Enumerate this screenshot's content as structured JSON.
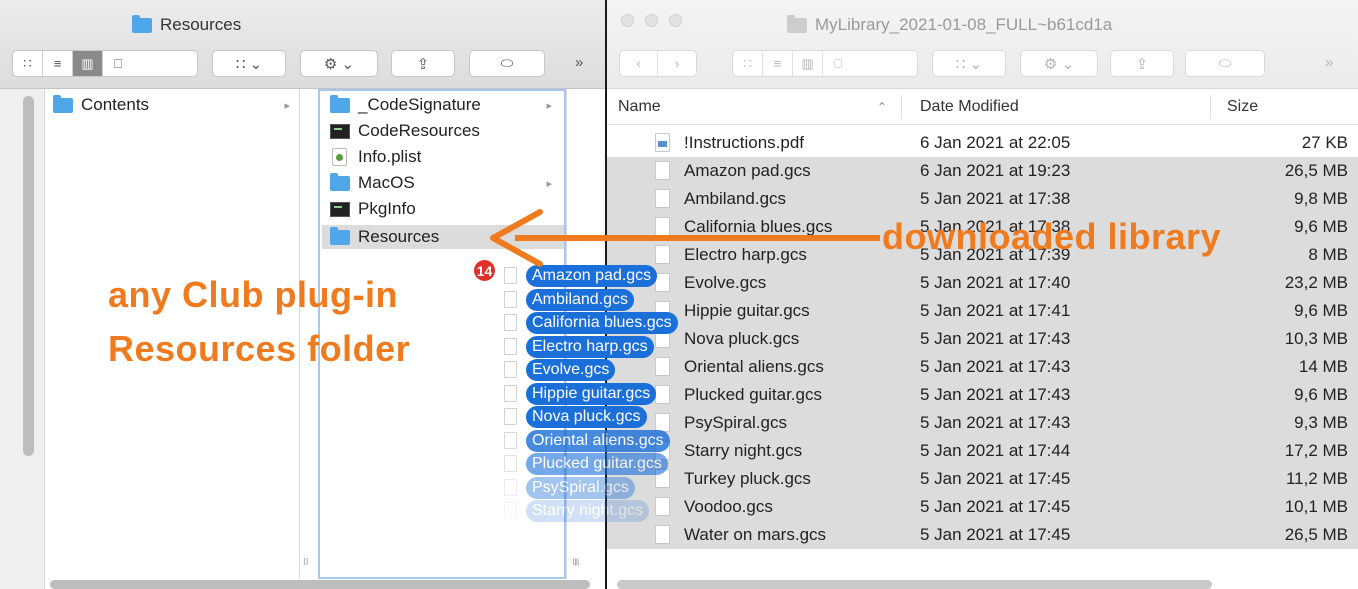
{
  "left_window": {
    "title": "Resources",
    "toolbar": {
      "view_icon": "∷",
      "list_icon": "≡",
      "column_icon": "▥",
      "gallery_icon": "⎕",
      "group_label": "∷ ⌄",
      "action_label": "⚙ ⌄",
      "share_label": "⇪",
      "tag_label": "⬭",
      "more_label": "»"
    },
    "column1": [
      {
        "label": "Contents",
        "icon": "folder-icon",
        "expandable": true
      }
    ],
    "column2": [
      {
        "label": "_CodeSignature",
        "icon": "folder-icon",
        "expandable": true
      },
      {
        "label": "CodeResources",
        "icon": "document-icon",
        "expandable": false
      },
      {
        "label": "Info.plist",
        "icon": "plist-icon",
        "expandable": false
      },
      {
        "label": "MacOS",
        "icon": "folder-icon",
        "expandable": true
      },
      {
        "label": "PkgInfo",
        "icon": "document-icon",
        "expandable": false
      },
      {
        "label": "Resources",
        "icon": "folder-icon",
        "expandable": true,
        "selected": true
      }
    ],
    "column_grip": "II",
    "chevron": "▸"
  },
  "right_window": {
    "title": "MyLibrary_2021-01-08_FULL~b61cd1a",
    "toolbar": {
      "back_label": "‹",
      "forward_label": "›",
      "view_icon": "∷",
      "list_icon": "≡",
      "column_icon": "▥",
      "gallery_icon": "⎕",
      "group_label": "∷ ⌄",
      "action_label": "⚙ ⌄",
      "share_label": "⇪",
      "tag_label": "⬭",
      "more_label": "»"
    },
    "columns": {
      "name": "Name",
      "sort_indicator": "⌃",
      "date": "Date Modified",
      "size": "Size"
    },
    "files": [
      {
        "name": "!Instructions.pdf",
        "date": "6 Jan 2021 at 22:05",
        "size": "27 KB",
        "icon": "pdf-icon",
        "selected": false
      },
      {
        "name": "Amazon pad.gcs",
        "date": "6 Jan 2021 at 19:23",
        "size": "26,5 MB",
        "icon": "file-icon",
        "selected": true
      },
      {
        "name": "Ambiland.gcs",
        "date": "5 Jan 2021 at 17:38",
        "size": "9,8 MB",
        "icon": "file-icon",
        "selected": true
      },
      {
        "name": "California blues.gcs",
        "date": "5 Jan 2021 at 17:38",
        "size": "9,6 MB",
        "icon": "file-icon",
        "selected": true
      },
      {
        "name": "Electro harp.gcs",
        "date": "5 Jan 2021 at 17:39",
        "size": "8 MB",
        "icon": "file-icon",
        "selected": true
      },
      {
        "name": "Evolve.gcs",
        "date": "5 Jan 2021 at 17:40",
        "size": "23,2 MB",
        "icon": "file-icon",
        "selected": true
      },
      {
        "name": "Hippie guitar.gcs",
        "date": "5 Jan 2021 at 17:41",
        "size": "9,6 MB",
        "icon": "file-icon",
        "selected": true
      },
      {
        "name": "Nova pluck.gcs",
        "date": "5 Jan 2021 at 17:43",
        "size": "10,3 MB",
        "icon": "file-icon",
        "selected": true
      },
      {
        "name": "Oriental aliens.gcs",
        "date": "5 Jan 2021 at 17:43",
        "size": "14 MB",
        "icon": "file-icon",
        "selected": true
      },
      {
        "name": "Plucked guitar.gcs",
        "date": "5 Jan 2021 at 17:43",
        "size": "9,6 MB",
        "icon": "file-icon",
        "selected": true
      },
      {
        "name": "PsySpiral.gcs",
        "date": "5 Jan 2021 at 17:43",
        "size": "9,3 MB",
        "icon": "file-icon",
        "selected": true
      },
      {
        "name": "Starry night.gcs",
        "date": "5 Jan 2021 at 17:44",
        "size": "17,2 MB",
        "icon": "file-icon",
        "selected": true
      },
      {
        "name": "Turkey pluck.gcs",
        "date": "5 Jan 2021 at 17:45",
        "size": "11,2 MB",
        "icon": "file-icon",
        "selected": true
      },
      {
        "name": "Voodoo.gcs",
        "date": "5 Jan 2021 at 17:45",
        "size": "10,1 MB",
        "icon": "file-icon",
        "selected": true
      },
      {
        "name": "Water on mars.gcs",
        "date": "5 Jan 2021 at 17:45",
        "size": "26,5 MB",
        "icon": "file-icon",
        "selected": true
      }
    ]
  },
  "drag": {
    "count": "14",
    "items": [
      "Amazon pad.gcs",
      "Ambiland.gcs",
      "California blues.gcs",
      "Electro harp.gcs",
      "Evolve.gcs",
      "Hippie guitar.gcs",
      "Nova pluck.gcs",
      "Oriental aliens.gcs",
      "Plucked guitar.gcs",
      "PsySpiral.gcs",
      "Starry night.gcs"
    ]
  },
  "annotations": {
    "library_label": "downloaded library",
    "resources_line1": "any Club plug-in",
    "resources_line2": "Resources folder",
    "color": "#f07a1e"
  },
  "colors": {
    "selection": "#1a6fd9",
    "badge": "#e0302b",
    "folder": "#4fa6e8"
  }
}
